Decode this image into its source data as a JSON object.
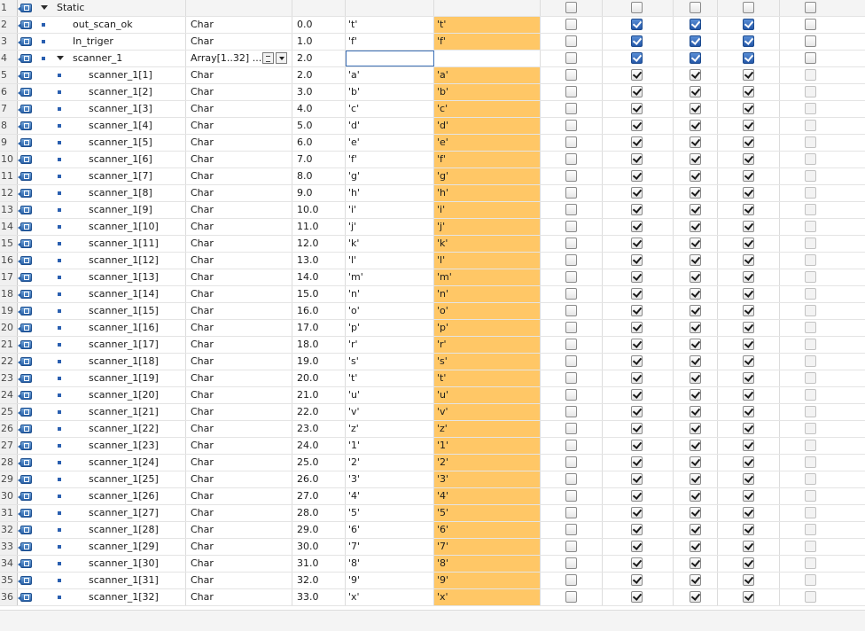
{
  "rows": [
    {
      "num": "1",
      "name": "Static",
      "type": "",
      "offset": "",
      "start": "",
      "monitor": "",
      "level": 0,
      "kind": "section",
      "checks": [
        "plain",
        "plain",
        "plain",
        "plain",
        "plain"
      ],
      "checked": [
        false,
        false,
        false,
        false,
        false
      ]
    },
    {
      "num": "2",
      "name": "out_scan_ok",
      "type": "Char",
      "offset": "0.0",
      "start": "'t'",
      "monitor": "'t'",
      "level": 1,
      "kind": "var",
      "checks": [
        "plain",
        "blue",
        "blue",
        "blue",
        "plain"
      ],
      "checked": [
        false,
        true,
        true,
        true,
        false
      ]
    },
    {
      "num": "3",
      "name": "In_triger",
      "type": "Char",
      "offset": "1.0",
      "start": "'f'",
      "monitor": "'f'",
      "level": 1,
      "kind": "var",
      "checks": [
        "plain",
        "blue",
        "blue",
        "blue",
        "plain"
      ],
      "checked": [
        false,
        true,
        true,
        true,
        false
      ]
    },
    {
      "num": "4",
      "name": "scanner_1",
      "type": "Array[1..32] ...",
      "offset": "2.0",
      "start": "",
      "monitor": "",
      "level": 1,
      "kind": "array",
      "checks": [
        "plain",
        "blue",
        "blue",
        "blue",
        "plain"
      ],
      "checked": [
        false,
        true,
        true,
        true,
        false
      ]
    },
    {
      "num": "5",
      "name": "scanner_1[1]",
      "type": "Char",
      "offset": "2.0",
      "start": "'a'",
      "monitor": "'a'",
      "level": 2,
      "kind": "elem",
      "checks": [
        "plain",
        "plain",
        "plain",
        "plain",
        "gray"
      ],
      "checked": [
        false,
        true,
        true,
        true,
        false
      ]
    },
    {
      "num": "6",
      "name": "scanner_1[2]",
      "type": "Char",
      "offset": "3.0",
      "start": "'b'",
      "monitor": "'b'",
      "level": 2,
      "kind": "elem",
      "checks": [
        "plain",
        "plain",
        "plain",
        "plain",
        "gray"
      ],
      "checked": [
        false,
        true,
        true,
        true,
        false
      ]
    },
    {
      "num": "7",
      "name": "scanner_1[3]",
      "type": "Char",
      "offset": "4.0",
      "start": "'c'",
      "monitor": "'c'",
      "level": 2,
      "kind": "elem",
      "checks": [
        "plain",
        "plain",
        "plain",
        "plain",
        "gray"
      ],
      "checked": [
        false,
        true,
        true,
        true,
        false
      ]
    },
    {
      "num": "8",
      "name": "scanner_1[4]",
      "type": "Char",
      "offset": "5.0",
      "start": "'d'",
      "monitor": "'d'",
      "level": 2,
      "kind": "elem",
      "checks": [
        "plain",
        "plain",
        "plain",
        "plain",
        "gray"
      ],
      "checked": [
        false,
        true,
        true,
        true,
        false
      ]
    },
    {
      "num": "9",
      "name": "scanner_1[5]",
      "type": "Char",
      "offset": "6.0",
      "start": "'e'",
      "monitor": "'e'",
      "level": 2,
      "kind": "elem",
      "checks": [
        "plain",
        "plain",
        "plain",
        "plain",
        "gray"
      ],
      "checked": [
        false,
        true,
        true,
        true,
        false
      ]
    },
    {
      "num": "10",
      "name": "scanner_1[6]",
      "type": "Char",
      "offset": "7.0",
      "start": "'f'",
      "monitor": "'f'",
      "level": 2,
      "kind": "elem",
      "checks": [
        "plain",
        "plain",
        "plain",
        "plain",
        "gray"
      ],
      "checked": [
        false,
        true,
        true,
        true,
        false
      ]
    },
    {
      "num": "11",
      "name": "scanner_1[7]",
      "type": "Char",
      "offset": "8.0",
      "start": "'g'",
      "monitor": "'g'",
      "level": 2,
      "kind": "elem",
      "checks": [
        "plain",
        "plain",
        "plain",
        "plain",
        "gray"
      ],
      "checked": [
        false,
        true,
        true,
        true,
        false
      ]
    },
    {
      "num": "12",
      "name": "scanner_1[8]",
      "type": "Char",
      "offset": "9.0",
      "start": "'h'",
      "monitor": "'h'",
      "level": 2,
      "kind": "elem",
      "checks": [
        "plain",
        "plain",
        "plain",
        "plain",
        "gray"
      ],
      "checked": [
        false,
        true,
        true,
        true,
        false
      ]
    },
    {
      "num": "13",
      "name": "scanner_1[9]",
      "type": "Char",
      "offset": "10.0",
      "start": "'i'",
      "monitor": "'i'",
      "level": 2,
      "kind": "elem",
      "checks": [
        "plain",
        "plain",
        "plain",
        "plain",
        "gray"
      ],
      "checked": [
        false,
        true,
        true,
        true,
        false
      ]
    },
    {
      "num": "14",
      "name": "scanner_1[10]",
      "type": "Char",
      "offset": "11.0",
      "start": "'j'",
      "monitor": "'j'",
      "level": 2,
      "kind": "elem",
      "checks": [
        "plain",
        "plain",
        "plain",
        "plain",
        "gray"
      ],
      "checked": [
        false,
        true,
        true,
        true,
        false
      ]
    },
    {
      "num": "15",
      "name": "scanner_1[11]",
      "type": "Char",
      "offset": "12.0",
      "start": "'k'",
      "monitor": "'k'",
      "level": 2,
      "kind": "elem",
      "checks": [
        "plain",
        "plain",
        "plain",
        "plain",
        "gray"
      ],
      "checked": [
        false,
        true,
        true,
        true,
        false
      ]
    },
    {
      "num": "16",
      "name": "scanner_1[12]",
      "type": "Char",
      "offset": "13.0",
      "start": "'l'",
      "monitor": "'l'",
      "level": 2,
      "kind": "elem",
      "checks": [
        "plain",
        "plain",
        "plain",
        "plain",
        "gray"
      ],
      "checked": [
        false,
        true,
        true,
        true,
        false
      ]
    },
    {
      "num": "17",
      "name": "scanner_1[13]",
      "type": "Char",
      "offset": "14.0",
      "start": "'m'",
      "monitor": "'m'",
      "level": 2,
      "kind": "elem",
      "checks": [
        "plain",
        "plain",
        "plain",
        "plain",
        "gray"
      ],
      "checked": [
        false,
        true,
        true,
        true,
        false
      ]
    },
    {
      "num": "18",
      "name": "scanner_1[14]",
      "type": "Char",
      "offset": "15.0",
      "start": "'n'",
      "monitor": "'n'",
      "level": 2,
      "kind": "elem",
      "checks": [
        "plain",
        "plain",
        "plain",
        "plain",
        "gray"
      ],
      "checked": [
        false,
        true,
        true,
        true,
        false
      ]
    },
    {
      "num": "19",
      "name": "scanner_1[15]",
      "type": "Char",
      "offset": "16.0",
      "start": "'o'",
      "monitor": "'o'",
      "level": 2,
      "kind": "elem",
      "checks": [
        "plain",
        "plain",
        "plain",
        "plain",
        "gray"
      ],
      "checked": [
        false,
        true,
        true,
        true,
        false
      ]
    },
    {
      "num": "20",
      "name": "scanner_1[16]",
      "type": "Char",
      "offset": "17.0",
      "start": "'p'",
      "monitor": "'p'",
      "level": 2,
      "kind": "elem",
      "checks": [
        "plain",
        "plain",
        "plain",
        "plain",
        "gray"
      ],
      "checked": [
        false,
        true,
        true,
        true,
        false
      ]
    },
    {
      "num": "21",
      "name": "scanner_1[17]",
      "type": "Char",
      "offset": "18.0",
      "start": "'r'",
      "monitor": "'r'",
      "level": 2,
      "kind": "elem",
      "checks": [
        "plain",
        "plain",
        "plain",
        "plain",
        "gray"
      ],
      "checked": [
        false,
        true,
        true,
        true,
        false
      ]
    },
    {
      "num": "22",
      "name": "scanner_1[18]",
      "type": "Char",
      "offset": "19.0",
      "start": "'s'",
      "monitor": "'s'",
      "level": 2,
      "kind": "elem",
      "checks": [
        "plain",
        "plain",
        "plain",
        "plain",
        "gray"
      ],
      "checked": [
        false,
        true,
        true,
        true,
        false
      ]
    },
    {
      "num": "23",
      "name": "scanner_1[19]",
      "type": "Char",
      "offset": "20.0",
      "start": "'t'",
      "monitor": "'t'",
      "level": 2,
      "kind": "elem",
      "checks": [
        "plain",
        "plain",
        "plain",
        "plain",
        "gray"
      ],
      "checked": [
        false,
        true,
        true,
        true,
        false
      ]
    },
    {
      "num": "24",
      "name": "scanner_1[20]",
      "type": "Char",
      "offset": "21.0",
      "start": "'u'",
      "monitor": "'u'",
      "level": 2,
      "kind": "elem",
      "checks": [
        "plain",
        "plain",
        "plain",
        "plain",
        "gray"
      ],
      "checked": [
        false,
        true,
        true,
        true,
        false
      ]
    },
    {
      "num": "25",
      "name": "scanner_1[21]",
      "type": "Char",
      "offset": "22.0",
      "start": "'v'",
      "monitor": "'v'",
      "level": 2,
      "kind": "elem",
      "checks": [
        "plain",
        "plain",
        "plain",
        "plain",
        "gray"
      ],
      "checked": [
        false,
        true,
        true,
        true,
        false
      ]
    },
    {
      "num": "26",
      "name": "scanner_1[22]",
      "type": "Char",
      "offset": "23.0",
      "start": "'z'",
      "monitor": "'z'",
      "level": 2,
      "kind": "elem",
      "checks": [
        "plain",
        "plain",
        "plain",
        "plain",
        "gray"
      ],
      "checked": [
        false,
        true,
        true,
        true,
        false
      ]
    },
    {
      "num": "27",
      "name": "scanner_1[23]",
      "type": "Char",
      "offset": "24.0",
      "start": "'1'",
      "monitor": "'1'",
      "level": 2,
      "kind": "elem",
      "checks": [
        "plain",
        "plain",
        "plain",
        "plain",
        "gray"
      ],
      "checked": [
        false,
        true,
        true,
        true,
        false
      ]
    },
    {
      "num": "28",
      "name": "scanner_1[24]",
      "type": "Char",
      "offset": "25.0",
      "start": "'2'",
      "monitor": "'2'",
      "level": 2,
      "kind": "elem",
      "checks": [
        "plain",
        "plain",
        "plain",
        "plain",
        "gray"
      ],
      "checked": [
        false,
        true,
        true,
        true,
        false
      ]
    },
    {
      "num": "29",
      "name": "scanner_1[25]",
      "type": "Char",
      "offset": "26.0",
      "start": "'3'",
      "monitor": "'3'",
      "level": 2,
      "kind": "elem",
      "checks": [
        "plain",
        "plain",
        "plain",
        "plain",
        "gray"
      ],
      "checked": [
        false,
        true,
        true,
        true,
        false
      ]
    },
    {
      "num": "30",
      "name": "scanner_1[26]",
      "type": "Char",
      "offset": "27.0",
      "start": "'4'",
      "monitor": "'4'",
      "level": 2,
      "kind": "elem",
      "checks": [
        "plain",
        "plain",
        "plain",
        "plain",
        "gray"
      ],
      "checked": [
        false,
        true,
        true,
        true,
        false
      ]
    },
    {
      "num": "31",
      "name": "scanner_1[27]",
      "type": "Char",
      "offset": "28.0",
      "start": "'5'",
      "monitor": "'5'",
      "level": 2,
      "kind": "elem",
      "checks": [
        "plain",
        "plain",
        "plain",
        "plain",
        "gray"
      ],
      "checked": [
        false,
        true,
        true,
        true,
        false
      ]
    },
    {
      "num": "32",
      "name": "scanner_1[28]",
      "type": "Char",
      "offset": "29.0",
      "start": "'6'",
      "monitor": "'6'",
      "level": 2,
      "kind": "elem",
      "checks": [
        "plain",
        "plain",
        "plain",
        "plain",
        "gray"
      ],
      "checked": [
        false,
        true,
        true,
        true,
        false
      ]
    },
    {
      "num": "33",
      "name": "scanner_1[29]",
      "type": "Char",
      "offset": "30.0",
      "start": "'7'",
      "monitor": "'7'",
      "level": 2,
      "kind": "elem",
      "checks": [
        "plain",
        "plain",
        "plain",
        "plain",
        "gray"
      ],
      "checked": [
        false,
        true,
        true,
        true,
        false
      ]
    },
    {
      "num": "34",
      "name": "scanner_1[30]",
      "type": "Char",
      "offset": "31.0",
      "start": "'8'",
      "monitor": "'8'",
      "level": 2,
      "kind": "elem",
      "checks": [
        "plain",
        "plain",
        "plain",
        "plain",
        "gray"
      ],
      "checked": [
        false,
        true,
        true,
        true,
        false
      ]
    },
    {
      "num": "35",
      "name": "scanner_1[31]",
      "type": "Char",
      "offset": "32.0",
      "start": "'9'",
      "monitor": "'9'",
      "level": 2,
      "kind": "elem",
      "checks": [
        "plain",
        "plain",
        "plain",
        "plain",
        "gray"
      ],
      "checked": [
        false,
        true,
        true,
        true,
        false
      ]
    },
    {
      "num": "36",
      "name": "scanner_1[32]",
      "type": "Char",
      "offset": "33.0",
      "start": "'x'",
      "monitor": "'x'",
      "level": 2,
      "kind": "elem",
      "checks": [
        "plain",
        "plain",
        "plain",
        "plain",
        "gray"
      ],
      "checked": [
        false,
        true,
        true,
        true,
        false
      ]
    }
  ],
  "colors": {
    "monitor_bg": "#ffc766",
    "tag_icon": "#2a62a8",
    "selection_border": "#3b6fb6"
  },
  "icons": {
    "tag": "tag-icon",
    "bullet": "bullet-icon",
    "expand": "expand-triangle-icon",
    "list": "list-icon",
    "dropdown": "dropdown-icon"
  }
}
